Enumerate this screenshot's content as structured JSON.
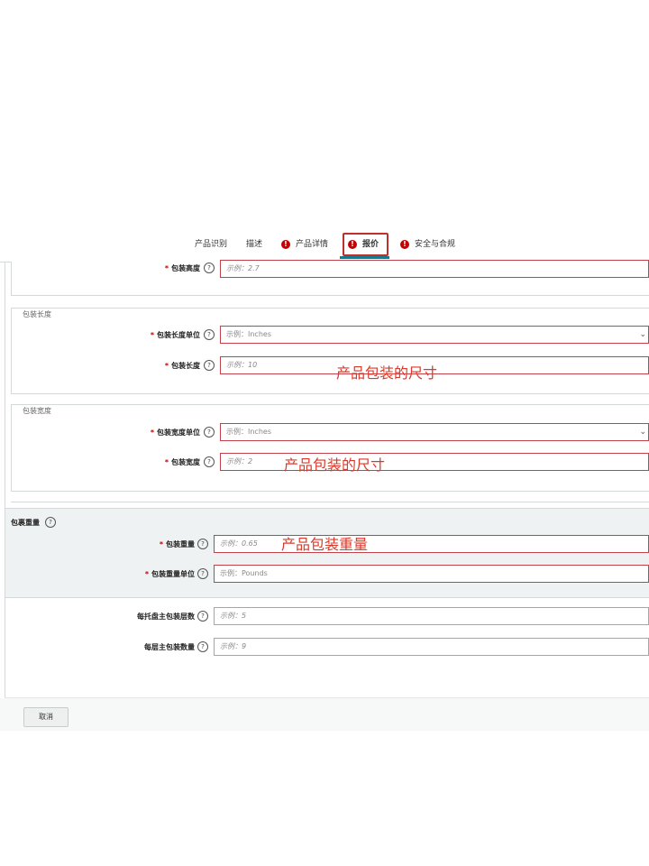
{
  "tabs": [
    {
      "label": "产品识别",
      "error": false,
      "active": false
    },
    {
      "label": "描述",
      "error": false,
      "active": false
    },
    {
      "label": "产品详情",
      "error": true,
      "active": false
    },
    {
      "label": "报价",
      "error": true,
      "active": true
    },
    {
      "label": "安全与合规",
      "error": true,
      "active": false
    }
  ],
  "error_glyph": "!",
  "help_glyph": "?",
  "required_mark": "*",
  "fields": {
    "package_height": {
      "label": "包装高度",
      "placeholder": "示例：2.7"
    },
    "package_length_unit": {
      "label": "包装长度单位",
      "value": "示例：Inches"
    },
    "package_length": {
      "label": "包装长度",
      "placeholder": "示例：10"
    },
    "package_width_unit": {
      "label": "包装宽度单位",
      "value": "示例：Inches"
    },
    "package_width": {
      "label": "包装宽度",
      "placeholder": "示例：2"
    },
    "package_weight": {
      "label": "包装重量",
      "placeholder": "示例：0.65"
    },
    "package_weight_unit": {
      "label": "包装重量单位",
      "value": "示例：Pounds"
    },
    "pallet_layers": {
      "label": "每托盘主包装层数",
      "placeholder": "示例：5"
    },
    "layer_quantity": {
      "label": "每层主包装数量",
      "placeholder": "示例：9"
    }
  },
  "groups": {
    "length_title": "包装长度",
    "width_title": "包装宽度",
    "weight_title": "包裹重量"
  },
  "annotations": {
    "length_note": "产品包装的尺寸",
    "width_note": "产品包装的尺寸",
    "weight_note": "产品包装重量"
  },
  "footer": {
    "cancel_label": "取消"
  },
  "colors": {
    "error_red": "#c40000",
    "active_tab": "#157a8c",
    "annotation": "#d93a2b"
  }
}
